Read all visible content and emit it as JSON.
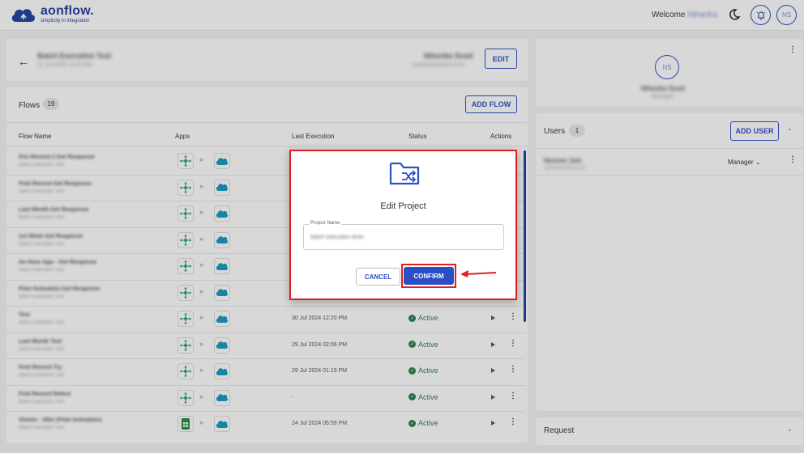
{
  "brand": {
    "name": "aonflow.",
    "tagline": "simplicity in integration"
  },
  "header": {
    "welcome_label": "Welcome",
    "user_first_name": "Niharika",
    "avatar_initials": "NS"
  },
  "project": {
    "name": "Batch Execution Test",
    "created": "31 Jul 2024 11:55 AM",
    "owner_name": "Niharika Sood",
    "owner_email": "nsood@aonflow.com",
    "edit_label": "EDIT"
  },
  "flows": {
    "title": "Flows",
    "count": "19",
    "add_label": "ADD FLOW",
    "columns": [
      "Flow Name",
      "Apps",
      "Last Execution",
      "Status",
      "Actions"
    ],
    "rows": [
      {
        "name": "Fire Record 2 Get Response",
        "project": "Batch Execution Test",
        "app": "workflow",
        "target": "salesforce",
        "last_execution": "",
        "status": ""
      },
      {
        "name": "Find Record Get Response",
        "project": "Batch Execution Test",
        "app": "workflow",
        "target": "salesforce",
        "last_execution": "",
        "status": ""
      },
      {
        "name": "Last Month Get Response",
        "project": "Batch Execution Test",
        "app": "workflow",
        "target": "salesforce",
        "last_execution": "",
        "status": ""
      },
      {
        "name": "1st Week Get Response",
        "project": "Batch Execution Test",
        "app": "workflow",
        "target": "salesforce",
        "last_execution": "",
        "status": ""
      },
      {
        "name": "An Hour Ago - Get Response",
        "project": "Batch Execution Test",
        "app": "workflow",
        "target": "salesforce",
        "last_execution": "",
        "status": ""
      },
      {
        "name": "Flow Activation Get Response",
        "project": "Batch Execution Test",
        "app": "workflow",
        "target": "salesforce",
        "last_execution": "",
        "status": ""
      },
      {
        "name": "Test",
        "project": "Batch Execution Test",
        "app": "workflow",
        "target": "salesforce",
        "last_execution": "30 Jul 2024 12:20 PM",
        "status": "Active"
      },
      {
        "name": "Last Month Test",
        "project": "Batch Execution Test",
        "app": "workflow",
        "target": "salesforce",
        "last_execution": "29 Jul 2024 02:06 PM",
        "status": "Active"
      },
      {
        "name": "Find Record Try",
        "project": "Batch Execution Test",
        "app": "workflow",
        "target": "salesforce",
        "last_execution": "29 Jul 2024 01:19 PM",
        "status": "Active"
      },
      {
        "name": "Find Record Retest",
        "project": "Batch Execution Test",
        "app": "workflow",
        "target": "salesforce",
        "last_execution": "-",
        "status": "Active"
      },
      {
        "name": "Sheets - Sfbx (Flow Activation)",
        "project": "Batch Execution Test",
        "app": "sheets",
        "target": "salesforce",
        "last_execution": "24 Jul 2024 05:59 PM",
        "status": "Active"
      }
    ]
  },
  "manager": {
    "initials": "NS",
    "name": "Niharika Sood",
    "role": "Manager"
  },
  "users": {
    "title": "Users",
    "count": "1",
    "add_label": "ADD USER",
    "list": [
      {
        "name": "Naveen Jain",
        "email": "njain@aonflow.com",
        "role": "Manager"
      }
    ]
  },
  "request": {
    "title": "Request"
  },
  "modal": {
    "title": "Edit Project",
    "field_label": "Project Name",
    "field_value": "batch execution tests",
    "cancel_label": "CANCEL",
    "confirm_label": "CONFIRM"
  },
  "colors": {
    "accent": "#2b4fc4",
    "active": "#2e7d4f",
    "highlight": "#e02020",
    "salesforce": "#1798c1",
    "sheets": "#1e8e3e"
  }
}
